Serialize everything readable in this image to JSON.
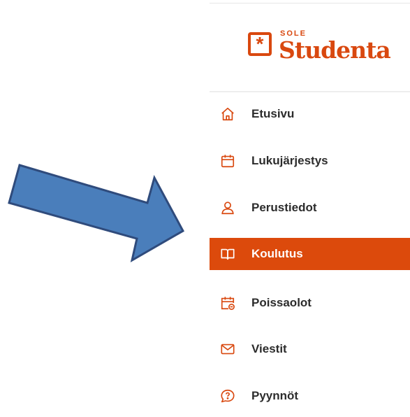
{
  "brand": {
    "small_text": "SOLE",
    "name": "Studenta",
    "mark_symbol": "*",
    "color": "#d9480f"
  },
  "nav": {
    "items": [
      {
        "label": "Etusivu",
        "icon": "home-icon",
        "active": false
      },
      {
        "label": "Lukujärjestys",
        "icon": "calendar-icon",
        "active": false
      },
      {
        "label": "Perustiedot",
        "icon": "user-icon",
        "active": false
      },
      {
        "label": "Koulutus",
        "icon": "book-icon",
        "active": true
      },
      {
        "label": "Poissaolot",
        "icon": "calendar-absence-icon",
        "active": false
      },
      {
        "label": "Viestit",
        "icon": "mail-icon",
        "active": false
      },
      {
        "label": "Pyynnöt",
        "icon": "question-bubble-icon",
        "active": false
      }
    ]
  },
  "annotation": {
    "arrow_icon": "right-arrow-icon",
    "arrow_color": "#4a7ebb",
    "arrow_outline_color": "#2f4b7c"
  },
  "colors": {
    "accent": "#dc4a0c",
    "text": "#2c2c2c"
  }
}
